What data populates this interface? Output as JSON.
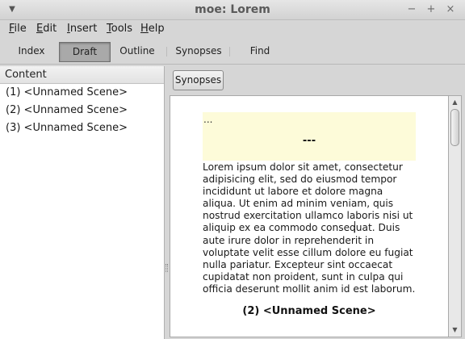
{
  "window": {
    "title": "moe: Lorem",
    "controls": [
      "−",
      "+",
      "×"
    ]
  },
  "menu": [
    {
      "pre": "",
      "accel": "F",
      "post": "ile"
    },
    {
      "pre": "",
      "accel": "E",
      "post": "dit"
    },
    {
      "pre": "",
      "accel": "I",
      "post": "nsert"
    },
    {
      "pre": "",
      "accel": "T",
      "post": "ools"
    },
    {
      "pre": "",
      "accel": "H",
      "post": "elp"
    }
  ],
  "tabs": [
    "Index",
    "Draft",
    "Outline",
    "Synopses",
    "Find"
  ],
  "active_tab": "Draft",
  "sidebar": {
    "header": "Content",
    "items": [
      "(1) <Unnamed Scene>",
      "(2) <Unnamed Scene>",
      "(3) <Unnamed Scene>"
    ]
  },
  "editor_toolbar": {
    "synopses_button": "Synopses"
  },
  "editor": {
    "synopsis_placeholder": "...",
    "scene_marker": "---",
    "body": "Lorem ipsum dolor sit amet, consectetur\nadipisicing elit, sed do eiusmod tempor\nincididunt ut labore et dolore magna\naliqua. Ut enim ad minim veniam, quis\nnostrud exercitation ullamco laboris nisi ut\naliquip ex ea commodo consequat. Duis\naute irure dolor in reprehenderit in\nvoluptate velit esse cillum dolore eu fugiat\nnulla pariatur. Excepteur sint occaecat\ncupidatat non proident, sunt in culpa qui\nofficia deserunt mollit anim id est laborum.",
    "next_scene_heading": "(2) <Unnamed Scene>"
  },
  "colors": {
    "synopsis_bg": "#fdfbd9",
    "active_tab_bg": "#a9a9a9",
    "window_bg": "#d6d6d6"
  },
  "icons": {
    "window_menu": "chevron-down-icon",
    "scroll_up": "triangle-up-icon",
    "scroll_down": "triangle-down-icon"
  }
}
